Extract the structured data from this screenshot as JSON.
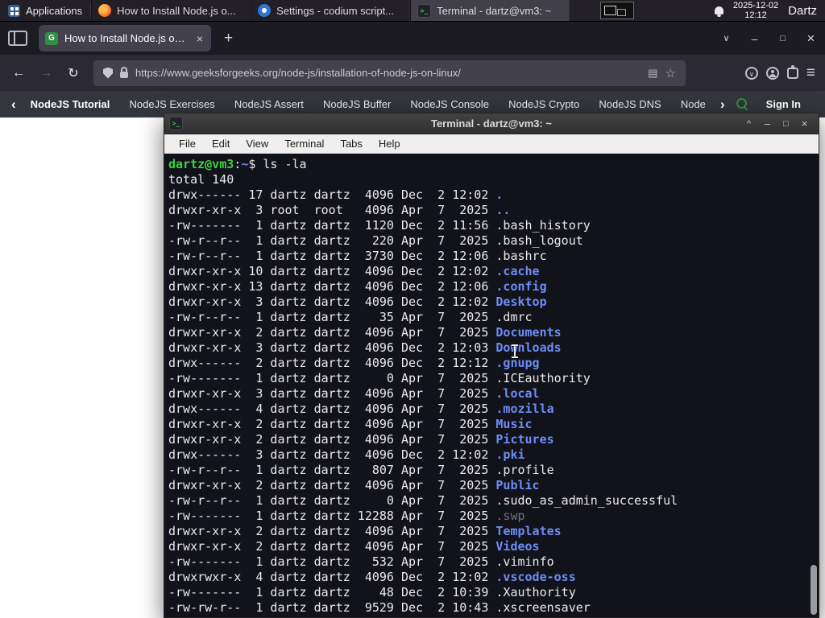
{
  "colors": {
    "accent_green": "#2f8d46",
    "terminal_green": "#3fd23f",
    "terminal_blue": "#6c8df5",
    "terminal_fg": "#eaeaea",
    "terminal_bg": "#12121a",
    "terminal_dim": "#72727e"
  },
  "icons": {
    "back": "←",
    "forward": "→",
    "reload": "↻",
    "star": "☆",
    "reader": "▤",
    "menu": "≡",
    "new_tab": "+",
    "close": "×",
    "minimize": "–",
    "maximize": "□",
    "shade": "^",
    "list_tabs": "∨",
    "chevron_left": "‹",
    "chevron_right": "›",
    "tab_favicon_letter": "G",
    "terminal_glyph": ">_",
    "pocket_glyph": "∨"
  },
  "panel": {
    "applications_label": "Applications",
    "windows": [
      {
        "title": "How to Install Node.js o..."
      },
      {
        "title": "Settings - codium script..."
      },
      {
        "title": "Terminal - dartz@vm3: ~"
      }
    ],
    "clock_date": "2025-12-02",
    "clock_time": "12:12",
    "user": "Dartz"
  },
  "browser": {
    "tab_title": "How to Install Node.js on...",
    "url": "https://www.geeksforgeeks.org/node-js/installation-of-node-js-on-linux/",
    "site_nav": [
      "NodeJS Tutorial",
      "NodeJS Exercises",
      "NodeJS Assert",
      "NodeJS Buffer",
      "NodeJS Console",
      "NodeJS Crypto",
      "NodeJS DNS",
      "Node"
    ],
    "sign_in_label": "Sign In"
  },
  "terminal": {
    "window_title": "Terminal - dartz@vm3: ~",
    "menu": [
      "File",
      "Edit",
      "View",
      "Terminal",
      "Tabs",
      "Help"
    ],
    "prompt": {
      "user": "dartz@vm3",
      "sep": ":",
      "path": "~",
      "suffix": "$"
    },
    "command": "ls -la",
    "total_line": "total 140",
    "listing": [
      [
        "drwx------",
        "17",
        "dartz",
        "dartz",
        "4096",
        "Dec",
        "2",
        "12:02",
        ".",
        "dir"
      ],
      [
        "drwxr-xr-x",
        "3",
        "root",
        "root",
        "4096",
        "Apr",
        "7",
        "2025",
        "..",
        "dir"
      ],
      [
        "-rw-------",
        "1",
        "dartz",
        "dartz",
        "1120",
        "Dec",
        "2",
        "11:56",
        ".bash_history",
        "file"
      ],
      [
        "-rw-r--r--",
        "1",
        "dartz",
        "dartz",
        "220",
        "Apr",
        "7",
        "2025",
        ".bash_logout",
        "file"
      ],
      [
        "-rw-r--r--",
        "1",
        "dartz",
        "dartz",
        "3730",
        "Dec",
        "2",
        "12:06",
        ".bashrc",
        "file"
      ],
      [
        "drwxr-xr-x",
        "10",
        "dartz",
        "dartz",
        "4096",
        "Dec",
        "2",
        "12:02",
        ".cache",
        "dir"
      ],
      [
        "drwxr-xr-x",
        "13",
        "dartz",
        "dartz",
        "4096",
        "Dec",
        "2",
        "12:06",
        ".config",
        "dir"
      ],
      [
        "drwxr-xr-x",
        "3",
        "dartz",
        "dartz",
        "4096",
        "Dec",
        "2",
        "12:02",
        "Desktop",
        "dir"
      ],
      [
        "-rw-r--r--",
        "1",
        "dartz",
        "dartz",
        "35",
        "Apr",
        "7",
        "2025",
        ".dmrc",
        "file"
      ],
      [
        "drwxr-xr-x",
        "2",
        "dartz",
        "dartz",
        "4096",
        "Apr",
        "7",
        "2025",
        "Documents",
        "dir"
      ],
      [
        "drwxr-xr-x",
        "3",
        "dartz",
        "dartz",
        "4096",
        "Dec",
        "2",
        "12:03",
        "Downloads",
        "dir"
      ],
      [
        "drwx------",
        "2",
        "dartz",
        "dartz",
        "4096",
        "Dec",
        "2",
        "12:12",
        ".gnupg",
        "dir"
      ],
      [
        "-rw-------",
        "1",
        "dartz",
        "dartz",
        "0",
        "Apr",
        "7",
        "2025",
        ".ICEauthority",
        "file"
      ],
      [
        "drwxr-xr-x",
        "3",
        "dartz",
        "dartz",
        "4096",
        "Apr",
        "7",
        "2025",
        ".local",
        "dir"
      ],
      [
        "drwx------",
        "4",
        "dartz",
        "dartz",
        "4096",
        "Apr",
        "7",
        "2025",
        ".mozilla",
        "dir"
      ],
      [
        "drwxr-xr-x",
        "2",
        "dartz",
        "dartz",
        "4096",
        "Apr",
        "7",
        "2025",
        "Music",
        "dir"
      ],
      [
        "drwxr-xr-x",
        "2",
        "dartz",
        "dartz",
        "4096",
        "Apr",
        "7",
        "2025",
        "Pictures",
        "dir"
      ],
      [
        "drwx------",
        "3",
        "dartz",
        "dartz",
        "4096",
        "Dec",
        "2",
        "12:02",
        ".pki",
        "dir"
      ],
      [
        "-rw-r--r--",
        "1",
        "dartz",
        "dartz",
        "807",
        "Apr",
        "7",
        "2025",
        ".profile",
        "file"
      ],
      [
        "drwxr-xr-x",
        "2",
        "dartz",
        "dartz",
        "4096",
        "Apr",
        "7",
        "2025",
        "Public",
        "dir"
      ],
      [
        "-rw-r--r--",
        "1",
        "dartz",
        "dartz",
        "0",
        "Apr",
        "7",
        "2025",
        ".sudo_as_admin_successful",
        "file"
      ],
      [
        "-rw-------",
        "1",
        "dartz",
        "dartz",
        "12288",
        "Apr",
        "7",
        "2025",
        ".swp",
        "dim"
      ],
      [
        "drwxr-xr-x",
        "2",
        "dartz",
        "dartz",
        "4096",
        "Apr",
        "7",
        "2025",
        "Templates",
        "dir"
      ],
      [
        "drwxr-xr-x",
        "2",
        "dartz",
        "dartz",
        "4096",
        "Apr",
        "7",
        "2025",
        "Videos",
        "dir"
      ],
      [
        "-rw-------",
        "1",
        "dartz",
        "dartz",
        "532",
        "Apr",
        "7",
        "2025",
        ".viminfo",
        "file"
      ],
      [
        "drwxrwxr-x",
        "4",
        "dartz",
        "dartz",
        "4096",
        "Dec",
        "2",
        "12:02",
        ".vscode-oss",
        "dir"
      ],
      [
        "-rw-------",
        "1",
        "dartz",
        "dartz",
        "48",
        "Dec",
        "2",
        "10:39",
        ".Xauthority",
        "file"
      ],
      [
        "-rw-rw-r--",
        "1",
        "dartz",
        "dartz",
        "9529",
        "Dec",
        "2",
        "10:43",
        ".xscreensaver",
        "file"
      ]
    ]
  }
}
